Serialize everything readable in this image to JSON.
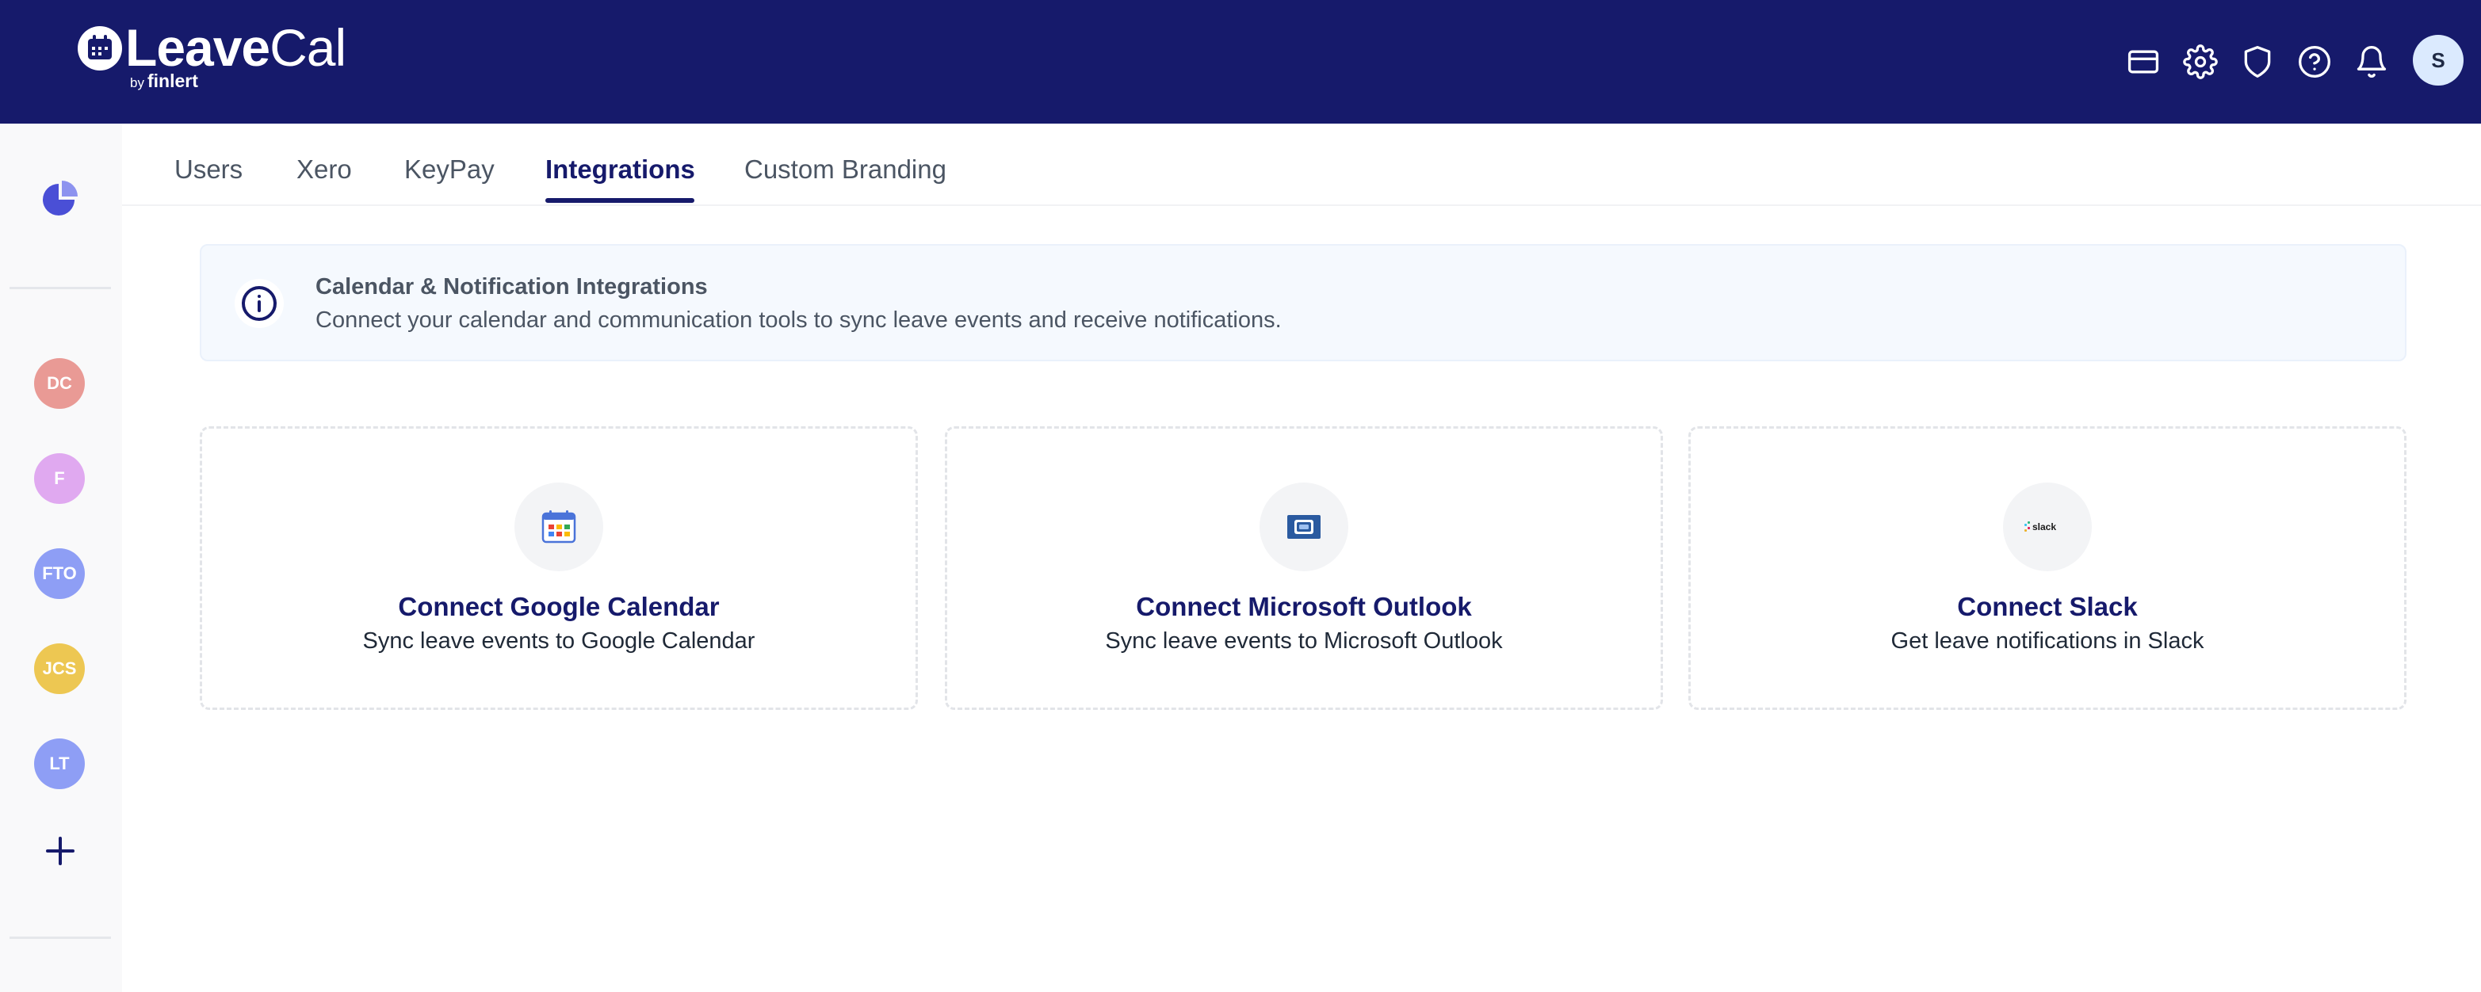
{
  "header": {
    "logo_text_bold": "Leave",
    "logo_text_light": "Cal",
    "logo_by": "by",
    "logo_company": "finlert",
    "icons": [
      "billing-card-icon",
      "gear-icon",
      "shield-icon",
      "help-icon",
      "bell-icon"
    ],
    "user_initial": "S"
  },
  "sidebar": {
    "teams": [
      {
        "initials": "DC",
        "color": "#e99a95"
      },
      {
        "initials": "F",
        "color": "#e0a9f0"
      },
      {
        "initials": "FTO",
        "color": "#8e9ef5"
      },
      {
        "initials": "JCS",
        "color": "#edc752"
      },
      {
        "initials": "LT",
        "color": "#8e9ef5"
      }
    ]
  },
  "tabs": [
    {
      "label": "Users",
      "active": false
    },
    {
      "label": "Xero",
      "active": false
    },
    {
      "label": "KeyPay",
      "active": false
    },
    {
      "label": "Integrations",
      "active": true
    },
    {
      "label": "Custom Branding",
      "active": false
    }
  ],
  "banner": {
    "title": "Calendar & Notification Integrations",
    "description": "Connect your calendar and communication tools to sync leave events and receive notifications."
  },
  "cards": [
    {
      "title": "Connect Google Calendar",
      "description": "Sync leave events to Google Calendar",
      "icon": "google-calendar-icon"
    },
    {
      "title": "Connect Microsoft Outlook",
      "description": "Sync leave events to Microsoft Outlook",
      "icon": "outlook-icon"
    },
    {
      "title": "Connect Slack",
      "description": "Get leave notifications in Slack",
      "icon": "slack-icon",
      "icon_text": "slack"
    }
  ]
}
